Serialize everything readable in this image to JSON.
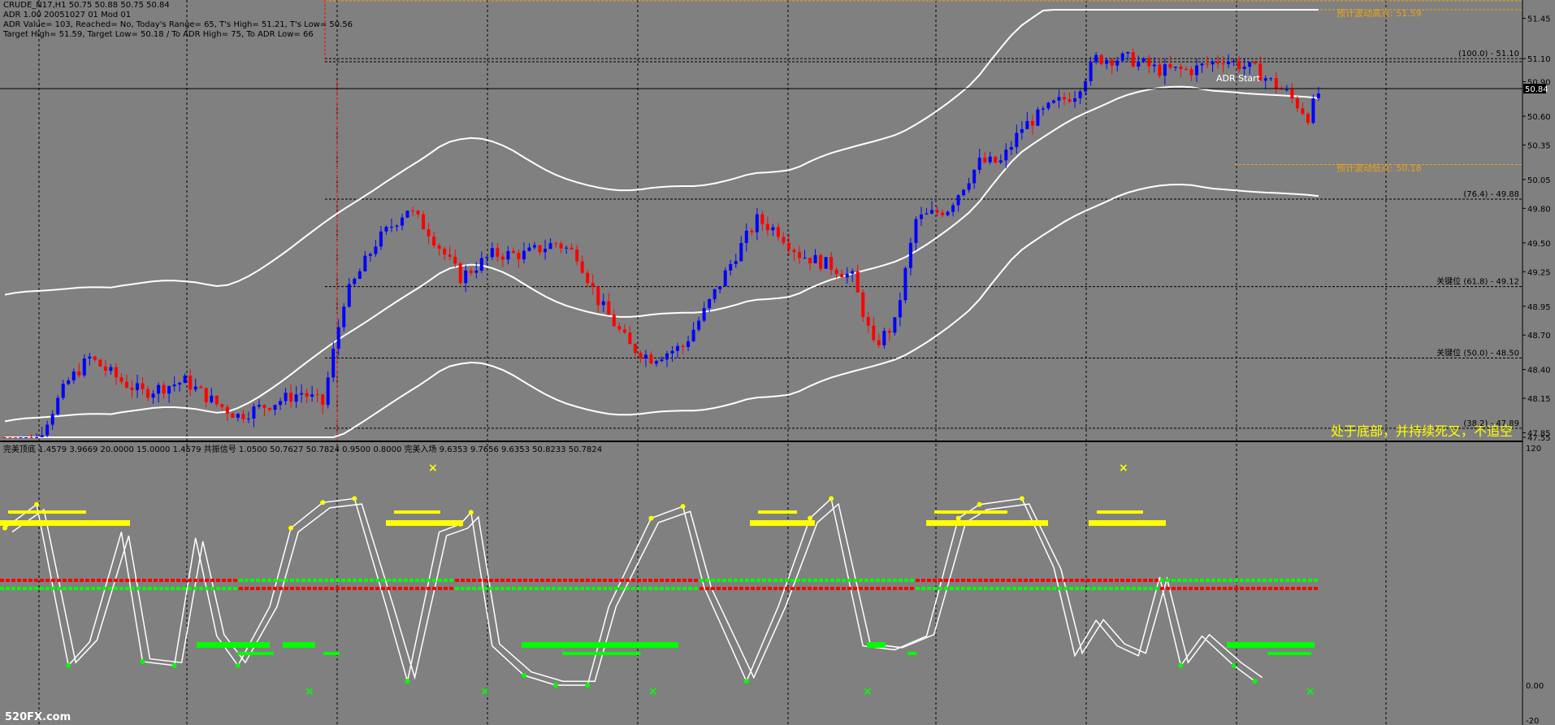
{
  "window": {
    "symbol_line": "CRUDE_N17,H1  50.75 50.88 50.75 50.84",
    "info_lines": [
      "ADR 1.00 20051027 01 Mod 01",
      "ADR Value= 103, Reached= No, Today's Range= 65, T's High= 51.21, T's Low= 50.56",
      "Target High= 51.59, Target Low= 50.18 / To ADR High= 75, To ADR Low= 66"
    ],
    "sub_header": "完美顶底 1.4579 3.9669 20.0000 15.0000 1.4579  共振信号 1.0500 50.7627 50.7824 0.9500 0.8000  完美入场 9.6353 9.7656 9.6353 50.8233 50.7824",
    "note": "处于底部，并持续死叉，不追空",
    "watermark": "520FX.com",
    "adr_start_label": "ADR Start"
  },
  "colors": {
    "background": "#808080",
    "bull_candle": "#0000ff",
    "bear_candle": "#ff0000",
    "channel": "#ffffff",
    "target_line": "#e8a317",
    "yellow": "#ffff00",
    "green": "#00ff00",
    "red": "#ff0000"
  },
  "price_axis": {
    "ticks": [
      "51.45",
      "51.10",
      "50.90",
      "50.60",
      "50.35",
      "50.05",
      "49.80",
      "49.50",
      "49.25",
      "48.95",
      "48.70",
      "48.40",
      "48.15",
      "47.85",
      "47.55"
    ],
    "current_price": "50.84",
    "levels": [
      {
        "label": "(100.0) - 51.10",
        "price": 51.1
      },
      {
        "label": "(76.4) - 49.88",
        "price": 49.88
      },
      {
        "label": "关键位 (61.8) - 49.12",
        "price": 49.12
      },
      {
        "label": "关键位 (50.0) - 48.50",
        "price": 48.5
      },
      {
        "label": "(38.2) - 47.89",
        "price": 47.89
      }
    ],
    "targets": [
      {
        "label": "预计波动高点: 51.59",
        "price": 51.59
      },
      {
        "label": "预计波动低点: 50.18",
        "price": 50.18
      }
    ]
  },
  "osc_axis": {
    "ticks": [
      "120",
      "0.00",
      "-20"
    ]
  },
  "chart_data": [
    {
      "type": "candlestick",
      "title": "CRUDE_N17,H1",
      "ylim": [
        47.5,
        51.6
      ],
      "close_path": [
        [
          0,
          47.7
        ],
        [
          6,
          47.8
        ],
        [
          12,
          48.3
        ],
        [
          16,
          48.5
        ],
        [
          22,
          48.3
        ],
        [
          26,
          48.2
        ],
        [
          34,
          48.3
        ],
        [
          40,
          48.1
        ],
        [
          44,
          48.0
        ],
        [
          50,
          48.1
        ],
        [
          56,
          48.2
        ],
        [
          60,
          48.1
        ],
        [
          64,
          49.0
        ],
        [
          70,
          49.5
        ],
        [
          76,
          49.8
        ],
        [
          80,
          49.6
        ],
        [
          86,
          49.2
        ],
        [
          92,
          49.4
        ],
        [
          98,
          49.4
        ],
        [
          104,
          49.5
        ],
        [
          108,
          49.4
        ],
        [
          112,
          49.0
        ],
        [
          118,
          48.6
        ],
        [
          122,
          48.5
        ],
        [
          128,
          48.6
        ],
        [
          132,
          48.9
        ],
        [
          138,
          49.4
        ],
        [
          142,
          49.7
        ],
        [
          146,
          49.6
        ],
        [
          150,
          49.4
        ],
        [
          156,
          49.3
        ],
        [
          160,
          49.2
        ],
        [
          164,
          48.6
        ],
        [
          168,
          48.8
        ],
        [
          172,
          49.7
        ],
        [
          178,
          49.8
        ],
        [
          184,
          50.2
        ],
        [
          188,
          50.2
        ],
        [
          192,
          50.5
        ],
        [
          198,
          50.7
        ],
        [
          202,
          50.8
        ],
        [
          206,
          51.1
        ],
        [
          212,
          51.1
        ],
        [
          218,
          51.0
        ],
        [
          224,
          51.0
        ],
        [
          230,
          51.1
        ],
        [
          236,
          51.0
        ],
        [
          242,
          50.8
        ],
        [
          246,
          50.6
        ],
        [
          248,
          50.8
        ]
      ],
      "n_bars": 249
    },
    {
      "type": "line",
      "title": "完美顶底",
      "ylim": [
        -20,
        120
      ],
      "series": [
        {
          "name": "完美顶底",
          "values": [
            [
              0,
              80
            ],
            [
              6,
              92
            ],
            [
              12,
              10
            ],
            [
              16,
              22
            ],
            [
              22,
              78
            ],
            [
              26,
              12
            ],
            [
              32,
              10
            ],
            [
              36,
              75
            ],
            [
              40,
              25
            ],
            [
              44,
              10
            ],
            [
              50,
              40
            ],
            [
              54,
              80
            ],
            [
              60,
              93
            ],
            [
              66,
              95
            ],
            [
              72,
              40
            ],
            [
              76,
              2
            ],
            [
              82,
              78
            ],
            [
              86,
              82
            ],
            [
              88,
              88
            ],
            [
              92,
              20
            ],
            [
              98,
              5
            ],
            [
              104,
              0
            ],
            [
              110,
              0
            ],
            [
              114,
              40
            ],
            [
              122,
              85
            ],
            [
              128,
              91
            ],
            [
              132,
              50
            ],
            [
              140,
              2
            ],
            [
              146,
              40
            ],
            [
              152,
              85
            ],
            [
              156,
              95
            ],
            [
              162,
              20
            ],
            [
              168,
              18
            ],
            [
              174,
              25
            ],
            [
              180,
              85
            ],
            [
              184,
              92
            ],
            [
              192,
              95
            ],
            [
              198,
              60
            ],
            [
              202,
              15
            ],
            [
              206,
              33
            ],
            [
              210,
              20
            ],
            [
              214,
              15
            ],
            [
              218,
              55
            ],
            [
              222,
              10
            ],
            [
              226,
              25
            ],
            [
              232,
              10
            ],
            [
              236,
              2
            ]
          ]
        }
      ]
    }
  ]
}
